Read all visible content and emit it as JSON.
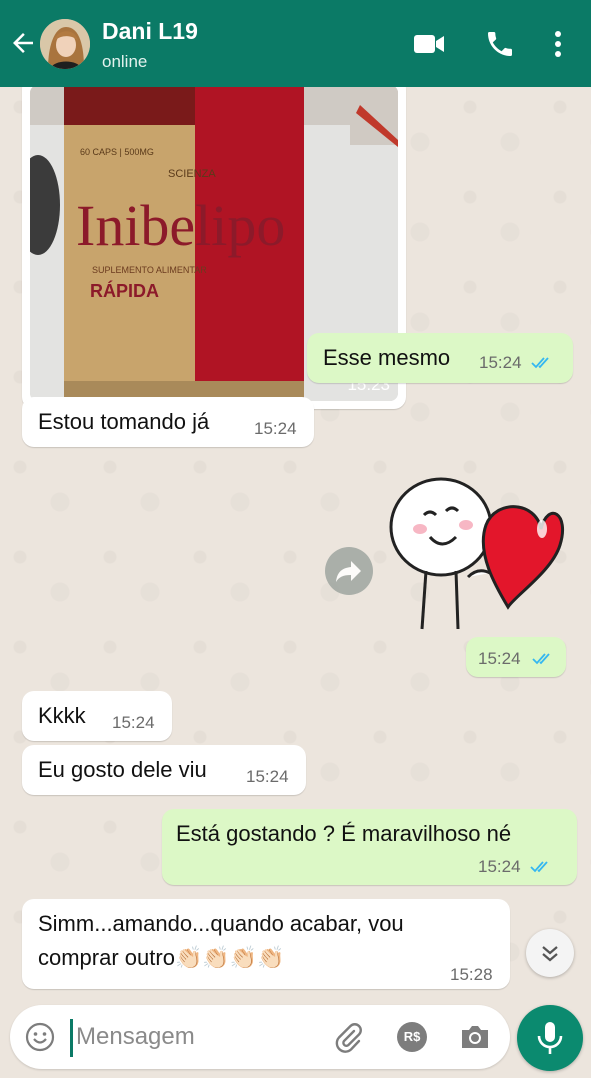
{
  "header": {
    "contact_name": "Dani L19",
    "status": "online"
  },
  "messages": [
    {
      "dir": "in",
      "type": "image",
      "time": "15:23"
    },
    {
      "dir": "out",
      "text": "Esse mesmo",
      "time": "15:24",
      "status": "read"
    },
    {
      "dir": "in",
      "text": "Estou tomando já",
      "time": "15:24"
    },
    {
      "dir": "out",
      "type": "sticker",
      "time": "15:24",
      "status": "read"
    },
    {
      "dir": "in",
      "text": "Kkkk",
      "time": "15:24"
    },
    {
      "dir": "in",
      "text": "Eu gosto dele viu",
      "time": "15:24"
    },
    {
      "dir": "out",
      "text": "Está gostando ? É maravilhoso né",
      "time": "15:24",
      "status": "read"
    },
    {
      "dir": "in",
      "text_line1": "Simm...amando...quando acabar, vou",
      "text_line2": "comprar outro",
      "emoji": "👏🏻👏🏻👏🏻👏🏻",
      "time": "15:28"
    }
  ],
  "photo": {
    "brand": "Inibelipo",
    "maker": "SCIENZA",
    "caption": "RÁPIDA"
  },
  "input": {
    "placeholder": "Mensagem",
    "pay_label": "R$"
  },
  "colors": {
    "header": "#0b7a66",
    "outgoing": "#dcf8c6",
    "incoming": "#ffffff",
    "read_ticks": "#34b7f1"
  },
  "icons": [
    "back-arrow-icon",
    "video-call-icon",
    "phone-icon",
    "more-vert-icon",
    "forward-icon",
    "chevron-down-icon",
    "emoji-icon",
    "attach-icon",
    "payment-icon",
    "camera-icon",
    "mic-icon"
  ]
}
